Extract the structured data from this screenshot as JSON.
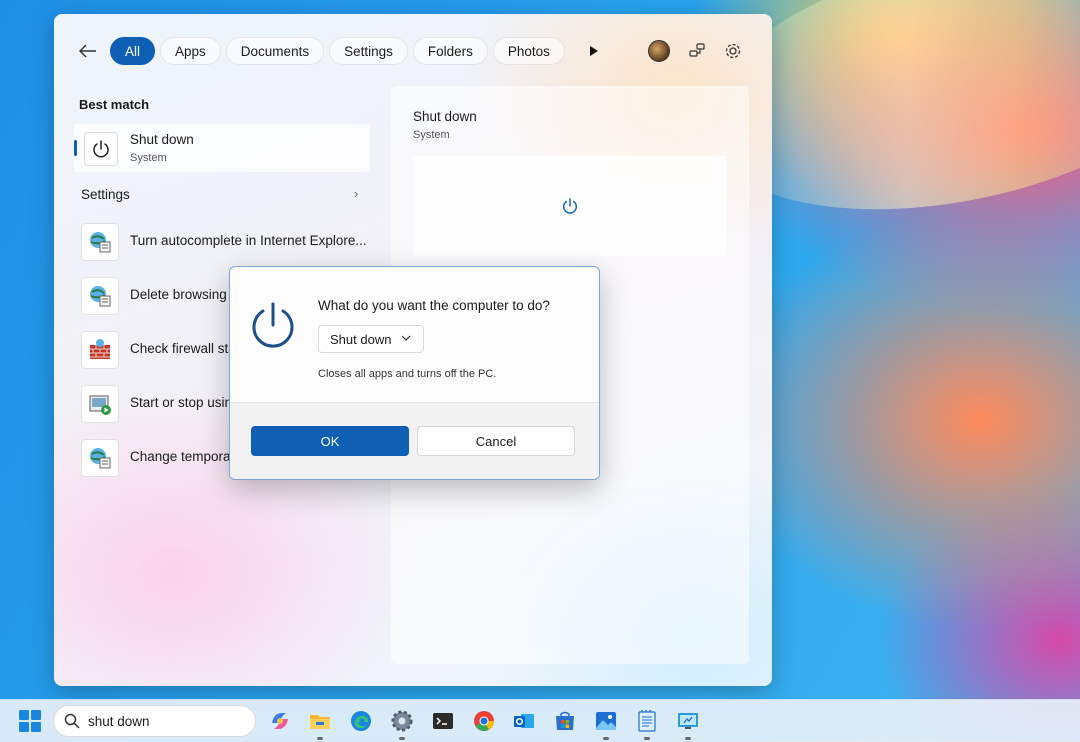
{
  "start": {
    "filters": [
      {
        "label": "All",
        "active": true
      },
      {
        "label": "Apps"
      },
      {
        "label": "Documents"
      },
      {
        "label": "Settings"
      },
      {
        "label": "Folders"
      },
      {
        "label": "Photos"
      }
    ],
    "best_match_label": "Best match",
    "best_match": {
      "title": "Shut down",
      "subtitle": "System"
    },
    "settings_label": "Settings",
    "settings_items": [
      {
        "label": "Turn autocomplete in Internet Explore...",
        "icon": "internet-options-icon"
      },
      {
        "label": "Delete browsing",
        "icon": "internet-options-icon"
      },
      {
        "label": "Check firewall sta",
        "icon": "firewall-icon"
      },
      {
        "label": "Start or stop usin",
        "icon": "autoplay-icon"
      },
      {
        "label": "Change tempora",
        "icon": "internet-options-icon"
      }
    ],
    "preview": {
      "title": "Shut down",
      "subtitle": "System"
    }
  },
  "dialog": {
    "question": "What do you want the computer to do?",
    "selected_option": "Shut down",
    "description": "Closes all apps and turns off the PC.",
    "ok_label": "OK",
    "cancel_label": "Cancel"
  },
  "taskbar": {
    "search_value": "shut down",
    "apps": [
      "copilot-icon",
      "file-explorer-icon",
      "edge-icon",
      "settings-icon",
      "terminal-icon",
      "chrome-icon",
      "outlook-icon",
      "store-icon",
      "photos-icon",
      "notepad-icon",
      "remote-desktop-icon"
    ]
  },
  "colors": {
    "accent": "#0f5fb5",
    "windows_blue": "#1a86e0"
  }
}
